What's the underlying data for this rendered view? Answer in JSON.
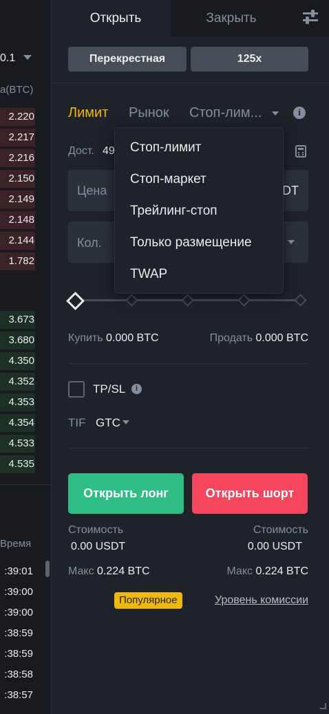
{
  "orderbook": {
    "header_value": "0.1",
    "header_unit": "a(BTC)",
    "asks": [
      "2.220",
      "2.217",
      "2.216",
      "2.150",
      "2.149",
      "2.148",
      "2.144",
      "1.782"
    ],
    "bids": [
      "3.673",
      "3.680",
      "4.350",
      "4.352",
      "4.353",
      "4.354",
      "4.533",
      "4.535"
    ],
    "trades_header": "Время",
    "trades": [
      ":39:01",
      ":39:00",
      ":39:00",
      ":38:59",
      ":38:59",
      ":38:58",
      ":38:57"
    ]
  },
  "tabs": {
    "open": "Открыть",
    "close": "Закрыть"
  },
  "margin_mode": "Перекрестная",
  "leverage": "125x",
  "order_types": {
    "limit": "Лимит",
    "market": "Рынок",
    "stop_limit": "Стоп-лим..."
  },
  "available": {
    "label": "Дост.",
    "value": "49"
  },
  "price_field": {
    "label": "Цена",
    "unit": "DT"
  },
  "qty_field": {
    "label": "Кол."
  },
  "dropdown": {
    "items": [
      "Стоп-лимит",
      "Стоп-маркет",
      "Трейлинг-стоп",
      "Только размещение",
      "TWAP"
    ]
  },
  "buy_info": {
    "label": "Купить",
    "value": "0.000 BTC"
  },
  "sell_info": {
    "label": "Продать",
    "value": "0.000 BTC"
  },
  "tpsl_label": "TP/SL",
  "tif": {
    "label": "TIF",
    "value": "GTC"
  },
  "open_long": "Открыть лонг",
  "open_short": "Открыть шорт",
  "cost_left": {
    "label": "Стоимость",
    "value": "0.00 USDT"
  },
  "cost_right": {
    "label": "Стоимость",
    "value": "0.00 USDT"
  },
  "max_left": {
    "label": "Макс",
    "value": "0.224 BTC"
  },
  "max_right": {
    "label": "Макс",
    "value": "0.224 BTC"
  },
  "popular_badge": "Популярное",
  "fee_link": "Уровень комиссии",
  "colors": {
    "accent": "#f0b90b",
    "long": "#2ebd85",
    "short": "#f6465d",
    "bg": "#1e2329"
  }
}
